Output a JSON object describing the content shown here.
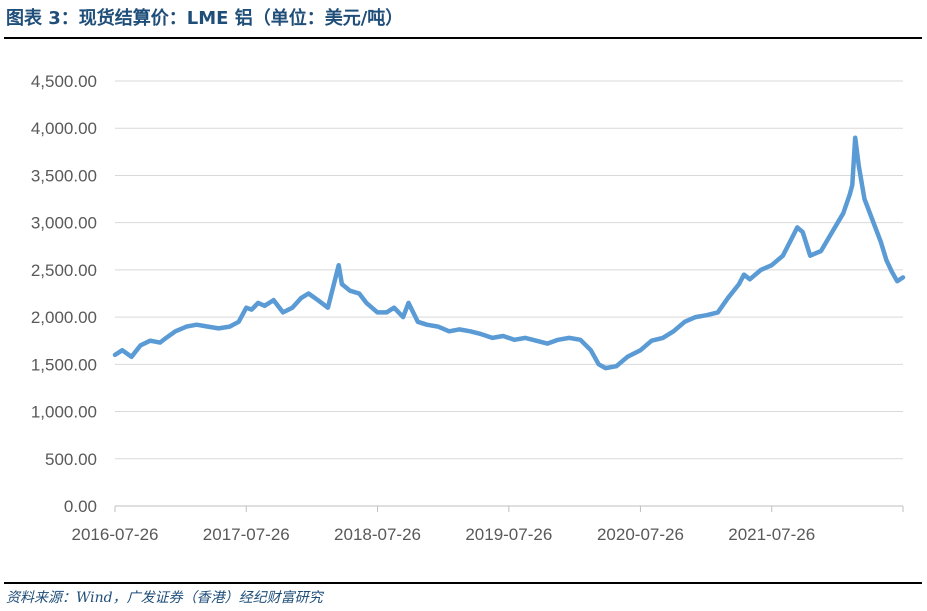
{
  "title": "图表 3：现货结算价：LME 铝（单位：美元/吨）",
  "source": "资料来源：Wind，广发证券（香港）经纪财富研究",
  "colors": {
    "line": "#5b9bd5",
    "grid": "#d9d9d9",
    "title": "#1f4e79",
    "tick": "#595959"
  },
  "chart_data": {
    "type": "line",
    "title": "",
    "xlabel": "",
    "ylabel": "",
    "ylim": [
      0,
      4500
    ],
    "xlim": [
      "2016-07-26",
      "2022-07-26"
    ],
    "x_tick_labels": [
      "2016-07-26",
      "2017-07-26",
      "2018-07-26",
      "2019-07-26",
      "2020-07-26",
      "2021-07-26"
    ],
    "y_tick_labels": [
      "0.00",
      "500.00",
      "1,000.00",
      "1,500.00",
      "2,000.00",
      "2,500.00",
      "3,000.00",
      "3,500.00",
      "4,000.00",
      "4,500.00"
    ],
    "grid": true,
    "legend": "none",
    "series": [
      {
        "x": [
          "2016-07-26",
          "2016-08-15",
          "2016-09-10",
          "2016-10-05",
          "2016-11-01",
          "2016-11-28",
          "2016-12-15",
          "2017-01-10",
          "2017-02-10",
          "2017-03-10",
          "2017-04-10",
          "2017-05-10",
          "2017-06-10",
          "2017-07-05",
          "2017-07-26",
          "2017-08-10",
          "2017-08-28",
          "2017-09-15",
          "2017-10-10",
          "2017-11-05",
          "2017-12-01",
          "2017-12-25",
          "2018-01-15",
          "2018-02-10",
          "2018-03-10",
          "2018-04-09",
          "2018-04-18",
          "2018-05-10",
          "2018-06-05",
          "2018-06-25",
          "2018-07-26",
          "2018-08-20",
          "2018-09-10",
          "2018-10-05",
          "2018-10-20",
          "2018-11-15",
          "2018-12-10",
          "2019-01-10",
          "2019-02-10",
          "2019-03-10",
          "2019-04-10",
          "2019-05-10",
          "2019-06-10",
          "2019-07-10",
          "2019-08-10",
          "2019-09-10",
          "2019-10-10",
          "2019-11-10",
          "2019-12-10",
          "2020-01-10",
          "2020-02-10",
          "2020-03-10",
          "2020-04-01",
          "2020-04-20",
          "2020-05-20",
          "2020-06-20",
          "2020-07-26",
          "2020-08-26",
          "2020-09-26",
          "2020-10-26",
          "2020-11-26",
          "2020-12-26",
          "2021-01-26",
          "2021-02-26",
          "2021-03-26",
          "2021-04-26",
          "2021-05-10",
          "2021-05-26",
          "2021-06-26",
          "2021-07-26",
          "2021-08-26",
          "2021-09-15",
          "2021-10-05",
          "2021-10-20",
          "2021-11-10",
          "2021-12-10",
          "2022-01-10",
          "2022-02-10",
          "2022-02-28",
          "2022-03-07",
          "2022-03-15",
          "2022-03-25",
          "2022-04-10",
          "2022-04-25",
          "2022-05-10",
          "2022-05-25",
          "2022-06-10",
          "2022-06-25",
          "2022-07-10",
          "2022-07-26"
        ],
        "values": [
          1600,
          1650,
          1580,
          1700,
          1750,
          1730,
          1780,
          1850,
          1900,
          1920,
          1900,
          1880,
          1900,
          1950,
          2100,
          2080,
          2150,
          2120,
          2180,
          2050,
          2100,
          2200,
          2250,
          2180,
          2100,
          2550,
          2350,
          2280,
          2250,
          2150,
          2050,
          2050,
          2100,
          2000,
          2150,
          1950,
          1920,
          1900,
          1850,
          1870,
          1850,
          1820,
          1780,
          1800,
          1760,
          1780,
          1750,
          1720,
          1760,
          1780,
          1760,
          1650,
          1500,
          1460,
          1480,
          1580,
          1650,
          1750,
          1780,
          1850,
          1950,
          2000,
          2020,
          2050,
          2200,
          2350,
          2450,
          2400,
          2500,
          2550,
          2650,
          2800,
          2950,
          2900,
          2650,
          2700,
          2900,
          3100,
          3300,
          3400,
          3900,
          3600,
          3250,
          3100,
          2950,
          2800,
          2600,
          2480,
          2380,
          2420
        ]
      }
    ]
  }
}
